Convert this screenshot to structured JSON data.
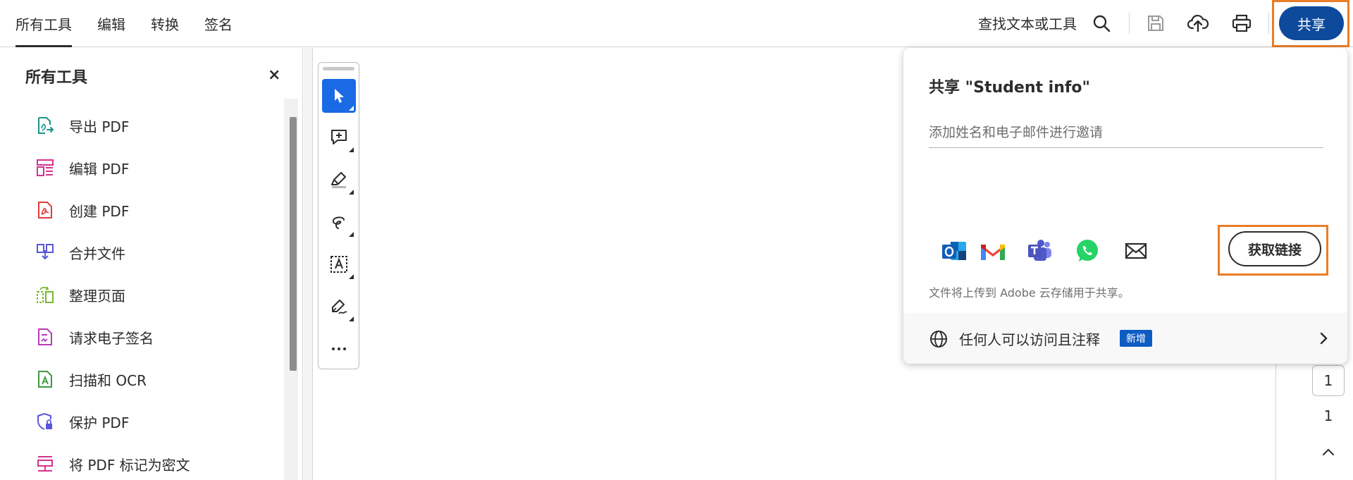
{
  "topnav": {
    "tabs": [
      {
        "label": "所有工具",
        "active": true
      },
      {
        "label": "编辑"
      },
      {
        "label": "转换"
      },
      {
        "label": "签名"
      }
    ]
  },
  "toolbar": {
    "search_label": "查找文本或工具",
    "share_label": "共享",
    "icons": [
      "search-icon",
      "save-icon",
      "cloud-upload-icon",
      "print-icon"
    ]
  },
  "left_panel": {
    "title": "所有工具",
    "close_glyph": "×",
    "tools": [
      {
        "label": "导出 PDF",
        "icon": "export-pdf-icon",
        "color": "#18948a"
      },
      {
        "label": "编辑 PDF",
        "icon": "edit-pdf-icon",
        "color": "#d3338c"
      },
      {
        "label": "创建 PDF",
        "icon": "create-pdf-icon",
        "color": "#e03b3b"
      },
      {
        "label": "合并文件",
        "icon": "combine-files-icon",
        "color": "#5a55d9"
      },
      {
        "label": "整理页面",
        "icon": "organize-pages-icon",
        "color": "#7cb82f"
      },
      {
        "label": "请求电子签名",
        "icon": "request-esign-icon",
        "color": "#b83ab8"
      },
      {
        "label": "扫描和 OCR",
        "icon": "scan-ocr-icon",
        "color": "#3e9a3e"
      },
      {
        "label": "保护 PDF",
        "icon": "protect-pdf-icon",
        "color": "#5a55d9"
      },
      {
        "label": "将 PDF 标记为密文",
        "icon": "redact-pdf-icon",
        "color": "#d3338c"
      }
    ]
  },
  "quick_tools": [
    "select-icon",
    "add-comment-icon",
    "highlight-icon",
    "draw-icon",
    "add-text-icon",
    "sign-icon",
    "more-icon"
  ],
  "share_popover": {
    "title": "共享 \"Student info\"",
    "invite_placeholder": "添加姓名和电子邮件进行邀请",
    "apps": [
      "outlook-icon",
      "gmail-icon",
      "teams-icon",
      "whatsapp-icon",
      "mail-icon"
    ],
    "get_link_label": "获取链接",
    "note": "文件将上传到 Adobe 云存储用于共享。",
    "access_label": "任何人可以访问且注释",
    "new_badge": "新增"
  },
  "page_nav": {
    "current_page": "1",
    "total_pages": "1"
  },
  "colors": {
    "accent": "#0d4a9c",
    "highlight": "#ea7d27",
    "active_tool": "#1b6ae5"
  }
}
